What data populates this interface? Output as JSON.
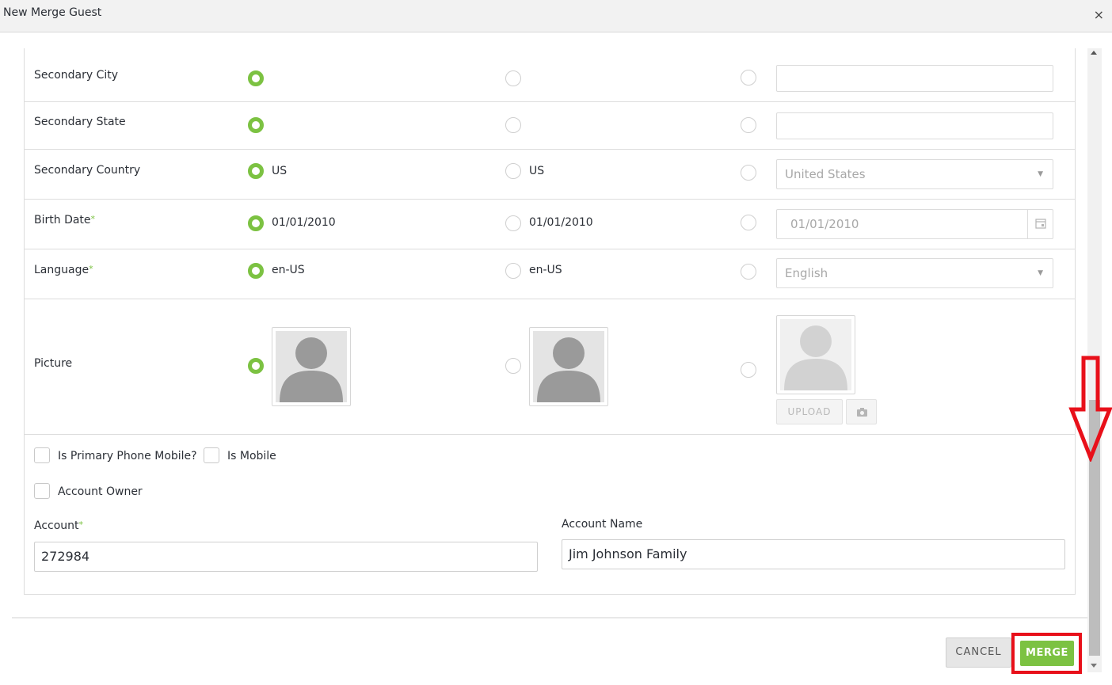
{
  "dialog": {
    "title": "New Merge Guest",
    "close_icon": "×"
  },
  "rows": {
    "secondary_city": {
      "label": "Secondary City",
      "opt1": "",
      "opt2": "",
      "input": ""
    },
    "secondary_state": {
      "label": "Secondary State",
      "opt1": "",
      "opt2": "",
      "input": ""
    },
    "secondary_country": {
      "label": "Secondary Country",
      "opt1": "US",
      "opt2": "US",
      "select": "United States"
    },
    "birth_date": {
      "label": "Birth Date",
      "required": "*",
      "opt1": "01/01/2010",
      "opt2": "01/01/2010",
      "input": "01/01/2010"
    },
    "language": {
      "label": "Language",
      "required": "*",
      "opt1": "en-US",
      "opt2": "en-US",
      "select": "English"
    },
    "picture": {
      "label": "Picture",
      "upload_label": "UPLOAD"
    }
  },
  "checkboxes": {
    "primary_phone_mobile": "Is Primary Phone Mobile?",
    "is_mobile": "Is Mobile",
    "account_owner": "Account Owner"
  },
  "account": {
    "label": "Account",
    "required": "*",
    "value": "272984"
  },
  "account_name": {
    "label": "Account Name",
    "value": "Jim Johnson Family"
  },
  "footer": {
    "cancel_label": "CANCEL",
    "merge_label": "MERGE"
  },
  "colors": {
    "accent": "#7cc242",
    "annotation": "#e8101a"
  },
  "icons": [
    "close-icon",
    "calendar-icon",
    "camera-icon",
    "chevron-down-icon",
    "avatar-placeholder-icon",
    "arrow-down-annotation"
  ]
}
